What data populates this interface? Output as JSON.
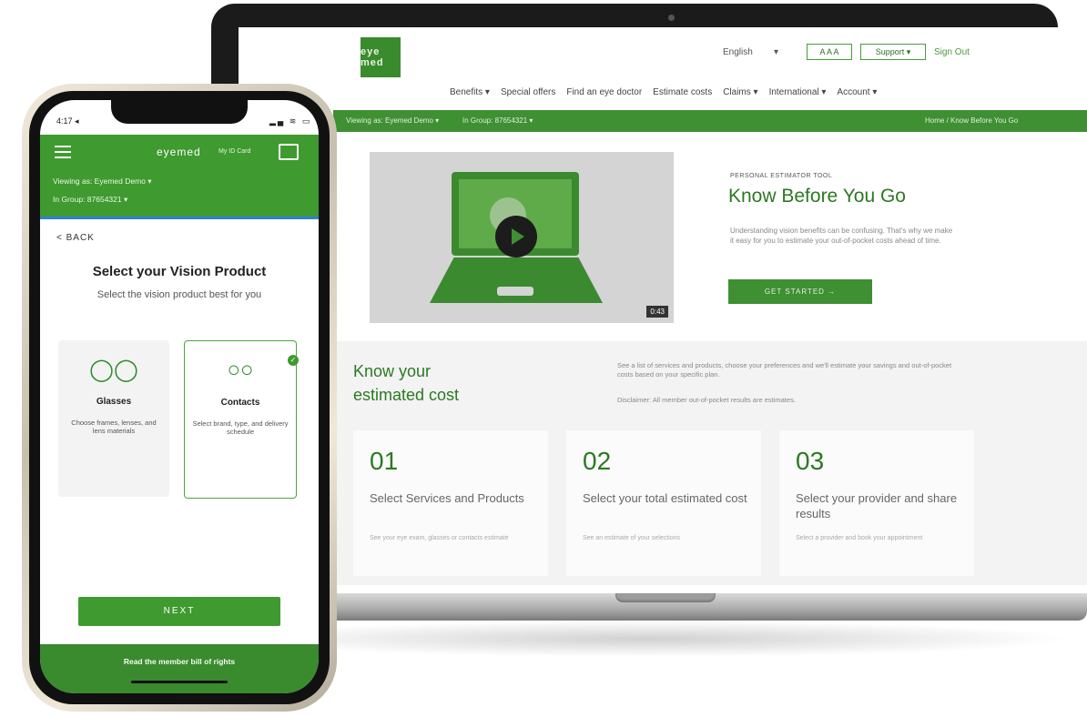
{
  "website": {
    "logo_text": "eye med",
    "language": "English",
    "language_caret": "▾",
    "text_size_label": "A A A",
    "support_label": "Support ▾",
    "signout_label": "Sign Out",
    "nav": [
      "Benefits ▾",
      "Special offers",
      "Find an eye doctor",
      "Estimate costs",
      "Claims ▾",
      "International ▾",
      "Account ▾"
    ],
    "viewing_as": "Viewing as: Eyemed Demo ▾",
    "in_group": "In Group: 87654321 ▾",
    "breadcrumb": "Home / Know Before You Go",
    "video_duration": "0:43",
    "hero": {
      "eyebrow": "PERSONAL ESTIMATOR TOOL",
      "title": "Know Before You Go",
      "description": "Understanding vision benefits can be confusing. That's why we make it easy for you to estimate your out-of-pocket costs ahead of time.",
      "cta": "GET STARTED →"
    },
    "cost": {
      "title": "Know your estimated cost",
      "description": "See a list of services and products, choose your preferences and we'll estimate your savings and out-of-pocket costs based on your specific plan.",
      "disclaimer": "Disclaimer: All member out-of-pocket results are estimates.",
      "steps": [
        {
          "num": "01",
          "title": "Select Services and Products",
          "desc": "See your eye exam, glasses or contacts estimate"
        },
        {
          "num": "02",
          "title": "Select your total estimated cost",
          "desc": "See an estimate of your selections"
        },
        {
          "num": "03",
          "title": "Select your provider and share results",
          "desc": "Select a provider and book your appointment"
        }
      ]
    }
  },
  "phone": {
    "time": "4:17 ◂",
    "status_icons": "▂▄ ≋ ▭",
    "app_logo": "eyemed",
    "id_card_label": "My ID Card",
    "viewing_as": "Viewing as: Eyemed Demo ▾",
    "in_group": "In Group: 87654321 ▾",
    "back_label": "<  BACK",
    "title": "Select your Vision Product",
    "subtitle": "Select the vision product best for you",
    "options": [
      {
        "icon": "glasses-icon",
        "glyph": "◯◯",
        "title": "Glasses",
        "desc": "Choose frames, lenses, and lens materials",
        "selected": false
      },
      {
        "icon": "contacts-icon",
        "glyph": "○○",
        "title": "Contacts",
        "desc": "Select brand, type, and delivery schedule",
        "selected": true
      }
    ],
    "check_glyph": "✓",
    "next_label": "NEXT",
    "footer_link": "Read the member bill of rights"
  },
  "colors": {
    "brand_green": "#3f8f33",
    "dark_green": "#2a7a22",
    "accent_blue": "#2f7fd8"
  }
}
